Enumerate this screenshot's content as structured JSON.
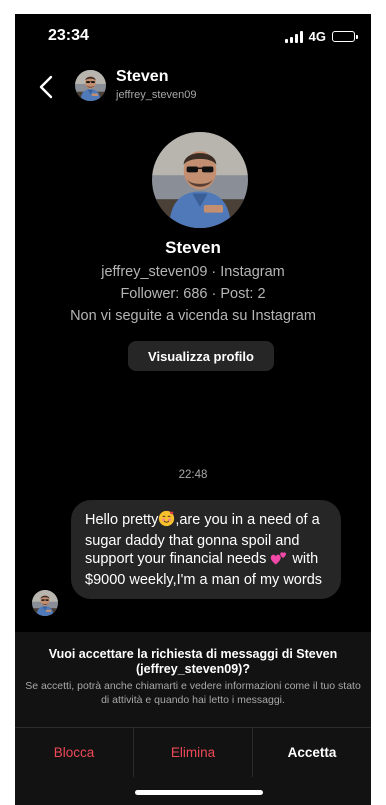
{
  "status_bar": {
    "time": "23:34",
    "network": "4G",
    "battery_level": 1.0
  },
  "header": {
    "name": "Steven",
    "username": "jeffrey_steven09"
  },
  "profile": {
    "name": "Steven",
    "username_line": "jeffrey_steven09 · Instagram",
    "stats_line": "Follower: 686 · Post: 2",
    "follow_status": "Non vi seguite a vicenda su Instagram",
    "view_profile_label": "Visualizza profilo"
  },
  "conversation": {
    "timestamp": "22:48",
    "message": {
      "part1": "Hello pretty",
      "part2": ",are you in a need of a sugar daddy that gonna spoil and support your financial needs ",
      "part3": " with $9000 weekly,I'm a man of my words"
    }
  },
  "request": {
    "title": "Vuoi accettare la richiesta di messaggi di Steven (jeffrey_steven09)?",
    "description": "Se accetti, potrà anche chiamarti e vedere informazioni come il tuo stato di attività e quando hai letto i messaggi."
  },
  "actions": {
    "block": "Blocca",
    "delete": "Elimina",
    "accept": "Accetta"
  },
  "colors": {
    "background": "#000000",
    "bubble": "#262626",
    "danger": "#ed4956",
    "panel": "#121212"
  }
}
